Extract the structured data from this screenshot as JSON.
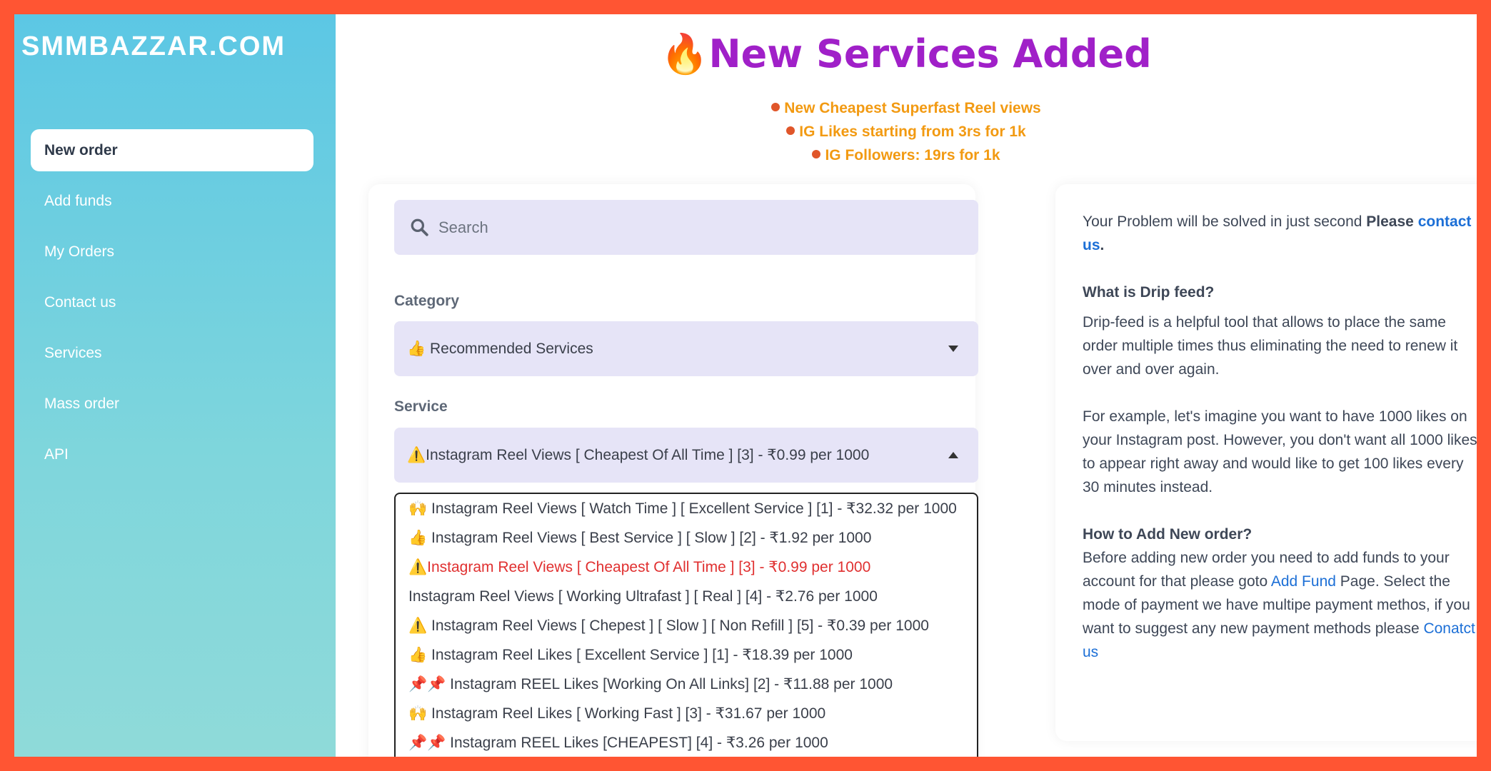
{
  "brand": "SMMBAZZAR.COM",
  "nav": [
    {
      "label": "New order",
      "active": true
    },
    {
      "label": "Add funds"
    },
    {
      "label": "My Orders"
    },
    {
      "label": "Contact us"
    },
    {
      "label": "Services"
    },
    {
      "label": "Mass order"
    },
    {
      "label": "API"
    }
  ],
  "headline": {
    "icon": "🔥",
    "text": "New Services Added"
  },
  "promos": [
    "New Cheapest Superfast Reel views",
    "IG Likes starting from 3rs for 1k",
    "IG Followers: 19rs for 1k"
  ],
  "search": {
    "placeholder": "Search"
  },
  "category": {
    "label": "Category",
    "value": "👍 Recommended Services"
  },
  "service": {
    "label": "Service",
    "value": "⚠️Instagram Reel Views [ Cheapest Of All Time ] [3] - ₹0.99 per 1000"
  },
  "options": [
    "🙌 Instagram Reel Views [ Watch Time ] [ Excellent Service ] [1] - ₹32.32 per 1000",
    "👍 Instagram Reel Views [ Best Service ] [ Slow ] [2] - ₹1.92 per 1000",
    "⚠️Instagram Reel Views [ Cheapest Of All Time ] [3] - ₹0.99 per 1000",
    "Instagram Reel Views [ Working Ultrafast ] [ Real ] [4] - ₹2.76 per 1000",
    "⚠️ Instagram Reel Views [ Chepest ] [ Slow ] [ Non Refill ] [5] - ₹0.39 per 1000",
    "👍 Instagram Reel Likes [ Excellent Service ] [1] - ₹18.39 per 1000",
    "📌📌 Instagram REEL Likes [Working On All Links] [2] - ₹11.88 per 1000",
    "🙌 Instagram Reel Likes [ Working Fast ] [3] - ₹31.67 per 1000",
    "📌📌 Instagram REEL Likes [CHEAPEST] [4] - ₹3.26 per 1000"
  ],
  "info": {
    "p1_text": "Your Problem will be solved in just second ",
    "p1_bold": "Please",
    "p1_link": "contact us",
    "p1_end": ".",
    "drip_title": "What is Drip feed?",
    "drip_p1": "Drip-feed is a helpful tool that allows to place the same order multiple times thus eliminating the need to renew it over and over again.",
    "drip_p2": "For example, let's imagine you want to have 1000 likes on your Instagram post. However, you don't want all 1000 likes to appear right away and would like to get 100 likes every 30 minutes instead.",
    "how_title": "How to Add New order?",
    "how_p1": "Before adding new order you need to add funds to your account for that please goto ",
    "how_link1": "Add Fund",
    "how_p2": " Page. Select the mode of payment we have multipe payment methos, if you want to suggest any new payment methods please ",
    "how_link2": "Conatct us"
  },
  "colors": {
    "accent": "#a020c8",
    "promo": "#f29a12",
    "border": "#ff5533",
    "link": "#1c6fd6",
    "selected": "#e03030"
  }
}
